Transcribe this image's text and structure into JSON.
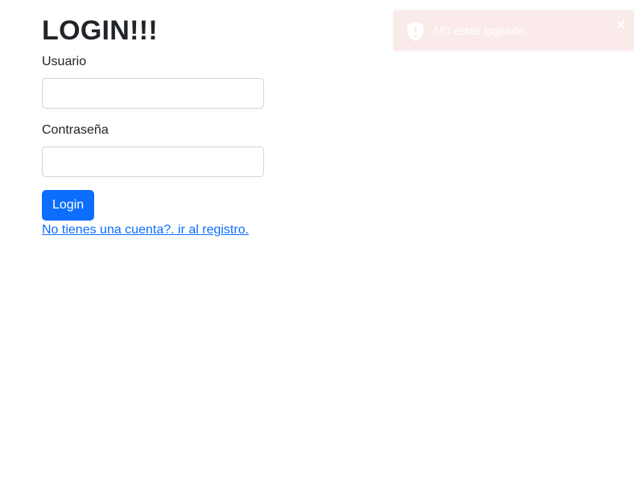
{
  "form": {
    "title": "LOGIN!!!",
    "username_label": "Usuario",
    "username_value": "",
    "password_label": "Contraseña",
    "password_value": "",
    "submit_label": "Login",
    "register_link": "No tienes una cuenta?. ir al registro."
  },
  "toast": {
    "message": "NO estas logeado.",
    "close_glyph": "×",
    "icon": "shield-exclamation-icon"
  },
  "colors": {
    "primary": "#0d6efd",
    "toast_bg": "#fbeaea",
    "text": "#212529",
    "input_border": "#ced4da"
  }
}
